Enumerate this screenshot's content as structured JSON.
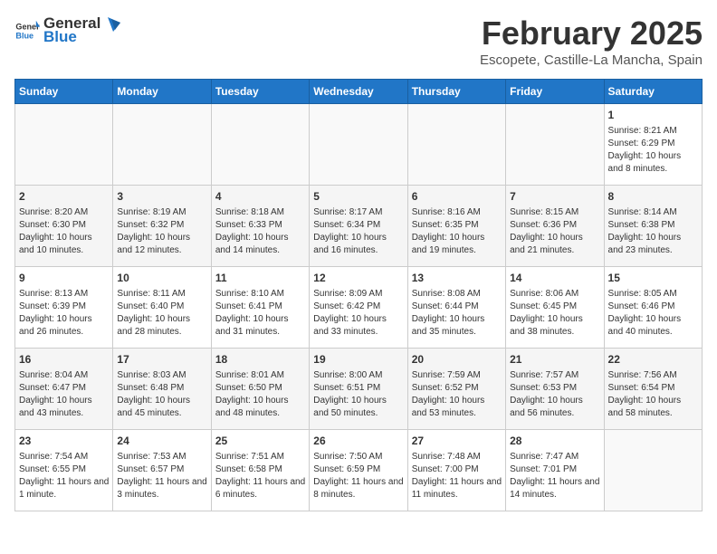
{
  "logo": {
    "text_general": "General",
    "text_blue": "Blue"
  },
  "header": {
    "title": "February 2025",
    "subtitle": "Escopete, Castille-La Mancha, Spain"
  },
  "weekdays": [
    "Sunday",
    "Monday",
    "Tuesday",
    "Wednesday",
    "Thursday",
    "Friday",
    "Saturday"
  ],
  "weeks": [
    [
      {
        "day": "",
        "info": ""
      },
      {
        "day": "",
        "info": ""
      },
      {
        "day": "",
        "info": ""
      },
      {
        "day": "",
        "info": ""
      },
      {
        "day": "",
        "info": ""
      },
      {
        "day": "",
        "info": ""
      },
      {
        "day": "1",
        "info": "Sunrise: 8:21 AM\nSunset: 6:29 PM\nDaylight: 10 hours and 8 minutes."
      }
    ],
    [
      {
        "day": "2",
        "info": "Sunrise: 8:20 AM\nSunset: 6:30 PM\nDaylight: 10 hours and 10 minutes."
      },
      {
        "day": "3",
        "info": "Sunrise: 8:19 AM\nSunset: 6:32 PM\nDaylight: 10 hours and 12 minutes."
      },
      {
        "day": "4",
        "info": "Sunrise: 8:18 AM\nSunset: 6:33 PM\nDaylight: 10 hours and 14 minutes."
      },
      {
        "day": "5",
        "info": "Sunrise: 8:17 AM\nSunset: 6:34 PM\nDaylight: 10 hours and 16 minutes."
      },
      {
        "day": "6",
        "info": "Sunrise: 8:16 AM\nSunset: 6:35 PM\nDaylight: 10 hours and 19 minutes."
      },
      {
        "day": "7",
        "info": "Sunrise: 8:15 AM\nSunset: 6:36 PM\nDaylight: 10 hours and 21 minutes."
      },
      {
        "day": "8",
        "info": "Sunrise: 8:14 AM\nSunset: 6:38 PM\nDaylight: 10 hours and 23 minutes."
      }
    ],
    [
      {
        "day": "9",
        "info": "Sunrise: 8:13 AM\nSunset: 6:39 PM\nDaylight: 10 hours and 26 minutes."
      },
      {
        "day": "10",
        "info": "Sunrise: 8:11 AM\nSunset: 6:40 PM\nDaylight: 10 hours and 28 minutes."
      },
      {
        "day": "11",
        "info": "Sunrise: 8:10 AM\nSunset: 6:41 PM\nDaylight: 10 hours and 31 minutes."
      },
      {
        "day": "12",
        "info": "Sunrise: 8:09 AM\nSunset: 6:42 PM\nDaylight: 10 hours and 33 minutes."
      },
      {
        "day": "13",
        "info": "Sunrise: 8:08 AM\nSunset: 6:44 PM\nDaylight: 10 hours and 35 minutes."
      },
      {
        "day": "14",
        "info": "Sunrise: 8:06 AM\nSunset: 6:45 PM\nDaylight: 10 hours and 38 minutes."
      },
      {
        "day": "15",
        "info": "Sunrise: 8:05 AM\nSunset: 6:46 PM\nDaylight: 10 hours and 40 minutes."
      }
    ],
    [
      {
        "day": "16",
        "info": "Sunrise: 8:04 AM\nSunset: 6:47 PM\nDaylight: 10 hours and 43 minutes."
      },
      {
        "day": "17",
        "info": "Sunrise: 8:03 AM\nSunset: 6:48 PM\nDaylight: 10 hours and 45 minutes."
      },
      {
        "day": "18",
        "info": "Sunrise: 8:01 AM\nSunset: 6:50 PM\nDaylight: 10 hours and 48 minutes."
      },
      {
        "day": "19",
        "info": "Sunrise: 8:00 AM\nSunset: 6:51 PM\nDaylight: 10 hours and 50 minutes."
      },
      {
        "day": "20",
        "info": "Sunrise: 7:59 AM\nSunset: 6:52 PM\nDaylight: 10 hours and 53 minutes."
      },
      {
        "day": "21",
        "info": "Sunrise: 7:57 AM\nSunset: 6:53 PM\nDaylight: 10 hours and 56 minutes."
      },
      {
        "day": "22",
        "info": "Sunrise: 7:56 AM\nSunset: 6:54 PM\nDaylight: 10 hours and 58 minutes."
      }
    ],
    [
      {
        "day": "23",
        "info": "Sunrise: 7:54 AM\nSunset: 6:55 PM\nDaylight: 11 hours and 1 minute."
      },
      {
        "day": "24",
        "info": "Sunrise: 7:53 AM\nSunset: 6:57 PM\nDaylight: 11 hours and 3 minutes."
      },
      {
        "day": "25",
        "info": "Sunrise: 7:51 AM\nSunset: 6:58 PM\nDaylight: 11 hours and 6 minutes."
      },
      {
        "day": "26",
        "info": "Sunrise: 7:50 AM\nSunset: 6:59 PM\nDaylight: 11 hours and 8 minutes."
      },
      {
        "day": "27",
        "info": "Sunrise: 7:48 AM\nSunset: 7:00 PM\nDaylight: 11 hours and 11 minutes."
      },
      {
        "day": "28",
        "info": "Sunrise: 7:47 AM\nSunset: 7:01 PM\nDaylight: 11 hours and 14 minutes."
      },
      {
        "day": "",
        "info": ""
      }
    ]
  ]
}
